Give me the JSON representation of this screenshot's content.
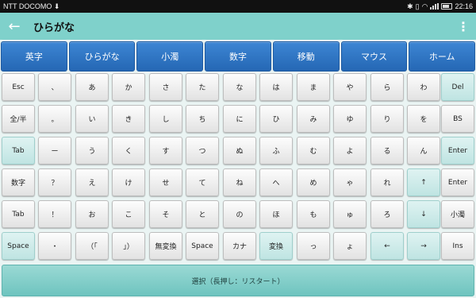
{
  "status": {
    "carrier": "NTT DOCOMO",
    "download_glyph": "⬇",
    "icons": [
      "bluetooth-icon",
      "vibrate-icon",
      "wifi-icon",
      "signal-icon",
      "battery-icon"
    ],
    "time": "22:16"
  },
  "appbar": {
    "back_glyph": "←",
    "title": "ひらがな",
    "menu_glyph": "⋮"
  },
  "tabs": [
    "英字",
    "ひらがな",
    "小濁",
    "数字",
    "移動",
    "マウス",
    "ホーム"
  ],
  "keys": [
    [
      "Esc",
      "、",
      "あ",
      "か",
      "さ",
      "た",
      "な",
      "は",
      "ま",
      "や",
      "ら",
      "わ",
      "Del"
    ],
    [
      "全/半",
      "。",
      "い",
      "き",
      "し",
      "ち",
      "に",
      "ひ",
      "み",
      "ゆ",
      "り",
      "を",
      "BS"
    ],
    [
      "Tab",
      "ー",
      "う",
      "く",
      "す",
      "つ",
      "ぬ",
      "ふ",
      "む",
      "よ",
      "る",
      "ん",
      "Enter"
    ],
    [
      "数字",
      "？",
      "え",
      "け",
      "せ",
      "て",
      "ね",
      "へ",
      "め",
      "ゃ",
      "れ",
      "↑",
      "Enter"
    ],
    [
      "Tab",
      "！",
      "お",
      "こ",
      "そ",
      "と",
      "の",
      "ほ",
      "も",
      "ゅ",
      "ろ",
      "↓",
      "小濁"
    ],
    [
      "Space",
      "・",
      "（「",
      "」）",
      "無変換",
      "Space",
      "カナ",
      "変換",
      "っ",
      "ょ",
      "←",
      "→",
      "Ins"
    ]
  ],
  "teal_keys": [
    "0-12",
    "2-0",
    "2-12",
    "3-11",
    "4-11",
    "5-0",
    "5-7",
    "5-10",
    "5-11"
  ],
  "select_bar": "選択（長押し：リスタート）",
  "colors": {
    "appbar": "#7fd1cb",
    "tab": "#2f74c4",
    "teal_key": "#cdeceb",
    "select_bar": "#83cfca"
  }
}
